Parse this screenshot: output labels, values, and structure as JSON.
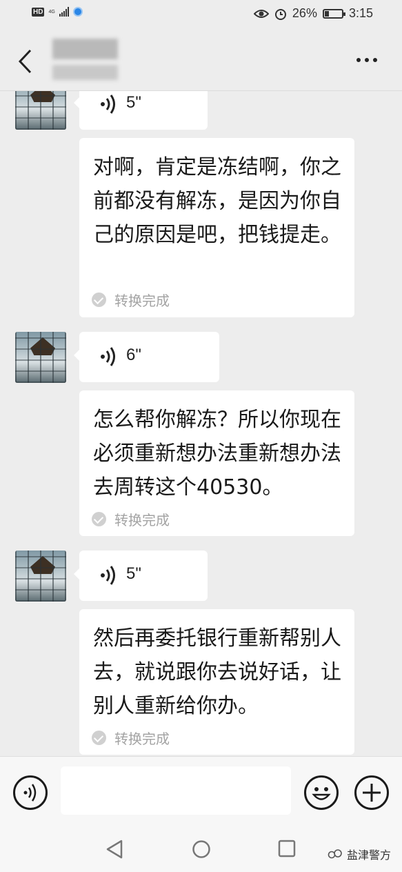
{
  "status_bar": {
    "hd": "HD",
    "network": "4G",
    "battery_percent": "26%",
    "battery_level": 0.26,
    "time": "3:15"
  },
  "header": {
    "back_icon": "chevron-left-icon",
    "more_icon": "more-dots-icon"
  },
  "messages": [
    {
      "type": "voice",
      "duration": "5\""
    },
    {
      "type": "transcript",
      "text": "对啊，肯定是冻结啊，你之前都没有解冻，是因为你自己的原因是吧，把钱提走。",
      "status": "转换完成"
    },
    {
      "type": "voice",
      "duration": "6\""
    },
    {
      "type": "transcript",
      "text": "怎么帮你解冻？所以你现在必须重新想办法重新想办法去周转这个40530。",
      "status": "转换完成"
    },
    {
      "type": "voice",
      "duration": "5\""
    },
    {
      "type": "transcript",
      "text": "然后再委托银行重新帮别人去，就说跟你去说好话，让别人重新给你办。",
      "status": "转换完成"
    }
  ],
  "input_bar": {
    "voice_icon": "voice-input-icon",
    "emoji_icon": "emoji-icon",
    "plus_icon": "plus-icon",
    "placeholder": ""
  },
  "nav_bar": {
    "back_icon": "triangle-back-icon",
    "home_icon": "circle-home-icon",
    "recent_icon": "square-recent-icon"
  },
  "watermark": "盐津警方"
}
